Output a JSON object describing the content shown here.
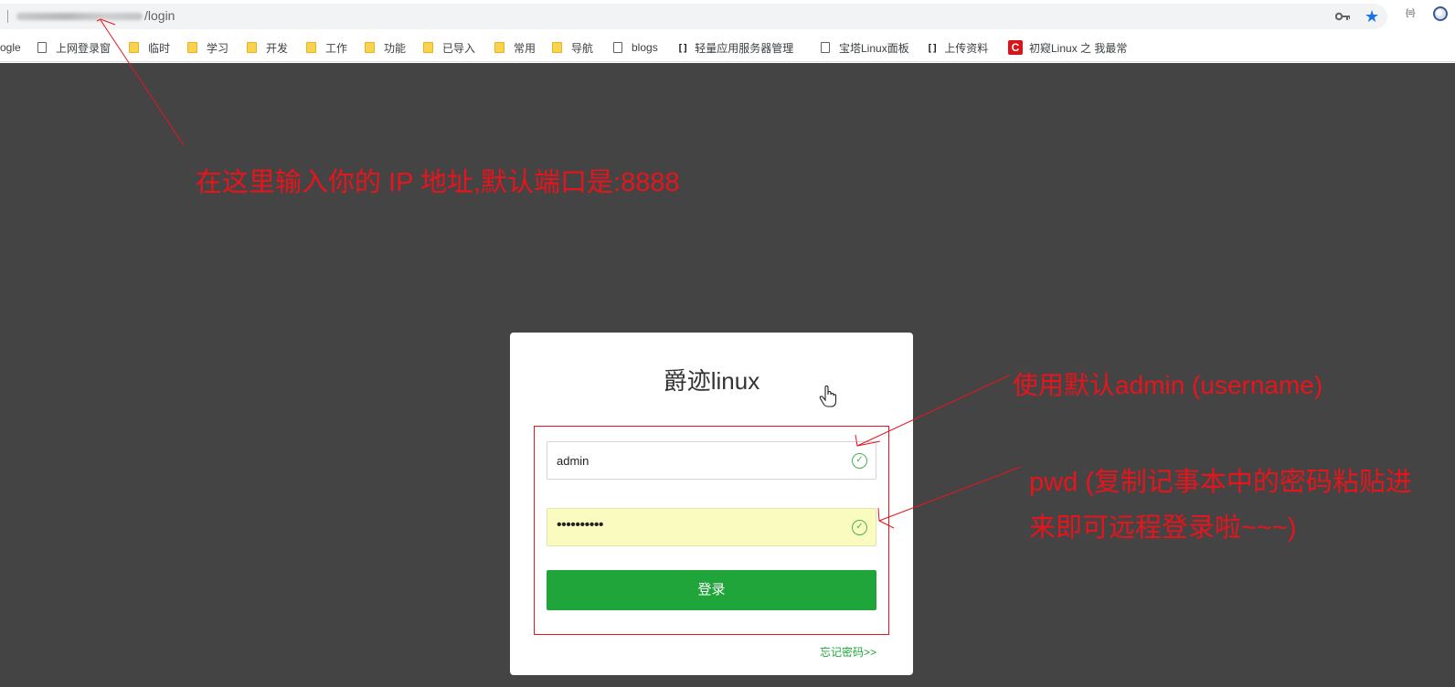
{
  "browser": {
    "url_suffix": "/login",
    "bookmarks": [
      {
        "label": "ogle",
        "type": "none"
      },
      {
        "label": "上网登录窗",
        "type": "page"
      },
      {
        "label": "临时",
        "type": "folder"
      },
      {
        "label": "学习",
        "type": "folder"
      },
      {
        "label": "开发",
        "type": "folder"
      },
      {
        "label": "工作",
        "type": "folder"
      },
      {
        "label": "功能",
        "type": "folder"
      },
      {
        "label": "已导入",
        "type": "folder"
      },
      {
        "label": "常用",
        "type": "folder"
      },
      {
        "label": "导航",
        "type": "folder"
      },
      {
        "label": "blogs",
        "type": "page"
      },
      {
        "label": "轻量应用服务器管理",
        "type": "cloud"
      },
      {
        "label": "宝塔Linux面板",
        "type": "page"
      },
      {
        "label": "上传资料",
        "type": "cloud"
      },
      {
        "label": "初窥Linux 之 我最常",
        "type": "csdn"
      }
    ],
    "extension_label": "{≡}"
  },
  "login": {
    "title": "爵迹linux",
    "username_value": "admin",
    "password_mask": "••••••••••",
    "submit_label": "登录",
    "forgot_label": "忘记密码>>"
  },
  "annotations": {
    "ip_hint": "在这里输入你的 IP 地址,默认端口是:8888",
    "user_hint": "使用默认admin (username)",
    "pwd_hint_line1": "pwd (复制记事本中的密码粘贴进",
    "pwd_hint_line2": "来即可远程登录啦~~~)"
  },
  "colors": {
    "page_bg": "#444444",
    "accent_green": "#20a53a",
    "annotation_red": "#e8141c",
    "autofill_yellow": "#fafcbf"
  }
}
